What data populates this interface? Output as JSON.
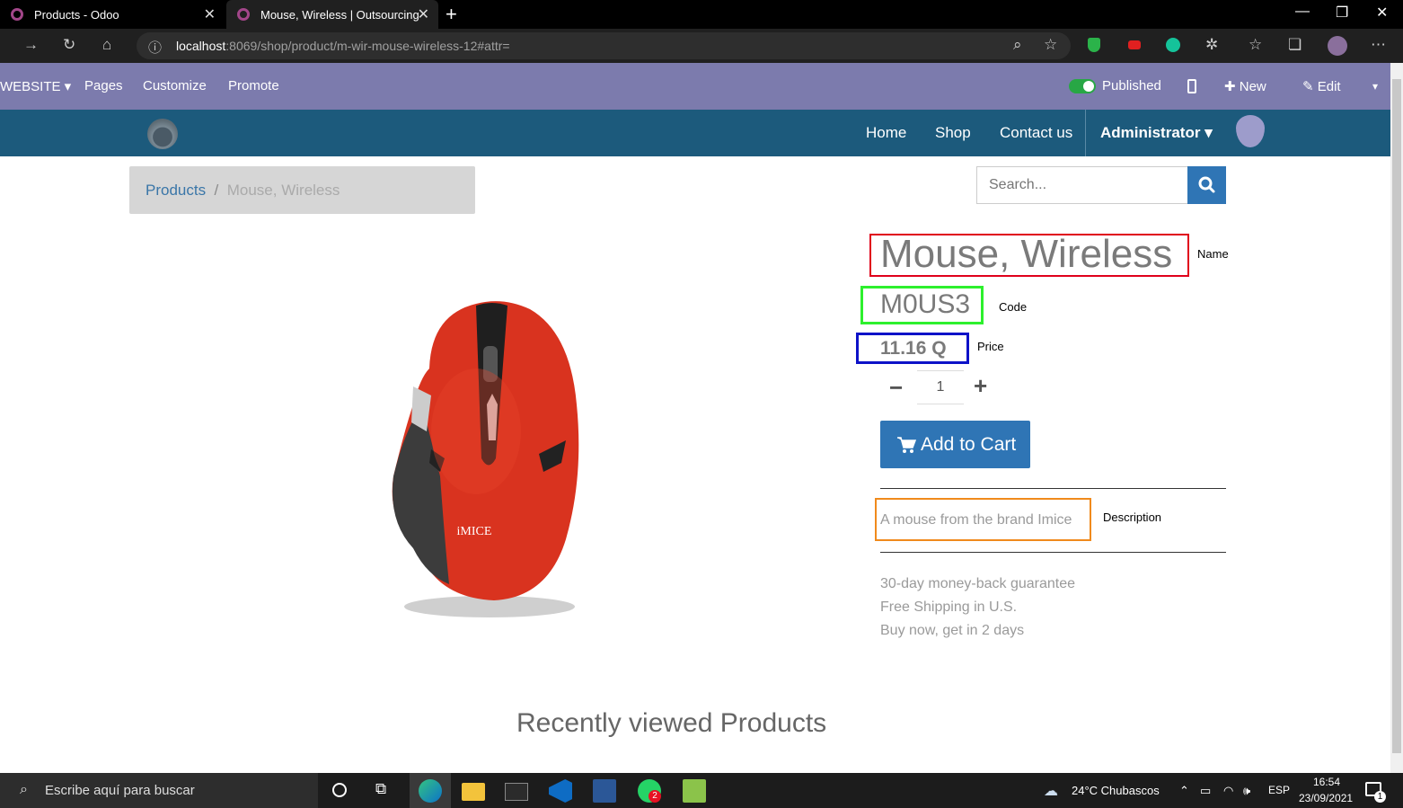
{
  "browser": {
    "tabs": [
      {
        "title": "Products - Odoo"
      },
      {
        "title": "Mouse, Wireless | Outsourcing"
      }
    ],
    "url_host": "localhost",
    "url_path": ":8069/shop/product/m-wir-mouse-wireless-12#attr="
  },
  "editbar": {
    "website": "WEBSITE",
    "pages": "Pages",
    "customize": "Customize",
    "promote": "Promote",
    "published": "Published",
    "new": "New",
    "edit": "Edit"
  },
  "nav": {
    "home": "Home",
    "shop": "Shop",
    "contact": "Contact us",
    "user": "Administrator"
  },
  "breadcrumb": {
    "root": "Products",
    "sep": "/",
    "current": "Mouse, Wireless"
  },
  "search": {
    "placeholder": "Search..."
  },
  "product": {
    "name": "Mouse, Wireless",
    "code": "M0US3",
    "price": "11.16 Q",
    "qty": "1",
    "add_to_cart": "Add to Cart",
    "description": "A mouse from the brand Imice",
    "image_brand": "iMICE"
  },
  "annotations": {
    "name": "Name",
    "code": "Code",
    "price": "Price",
    "description": "Description"
  },
  "guarantees": [
    "30-day money-back guarantee",
    "Free Shipping in U.S.",
    "Buy now, get in 2 days"
  ],
  "recent_title": "Recently viewed Products",
  "taskbar": {
    "search": "Escribe aquí para buscar",
    "weather": "24°C  Chubascos",
    "lang": "ESP",
    "time": "16:54",
    "date": "23/09/2021",
    "whatsapp_badge": "2",
    "notif_count": "1"
  }
}
